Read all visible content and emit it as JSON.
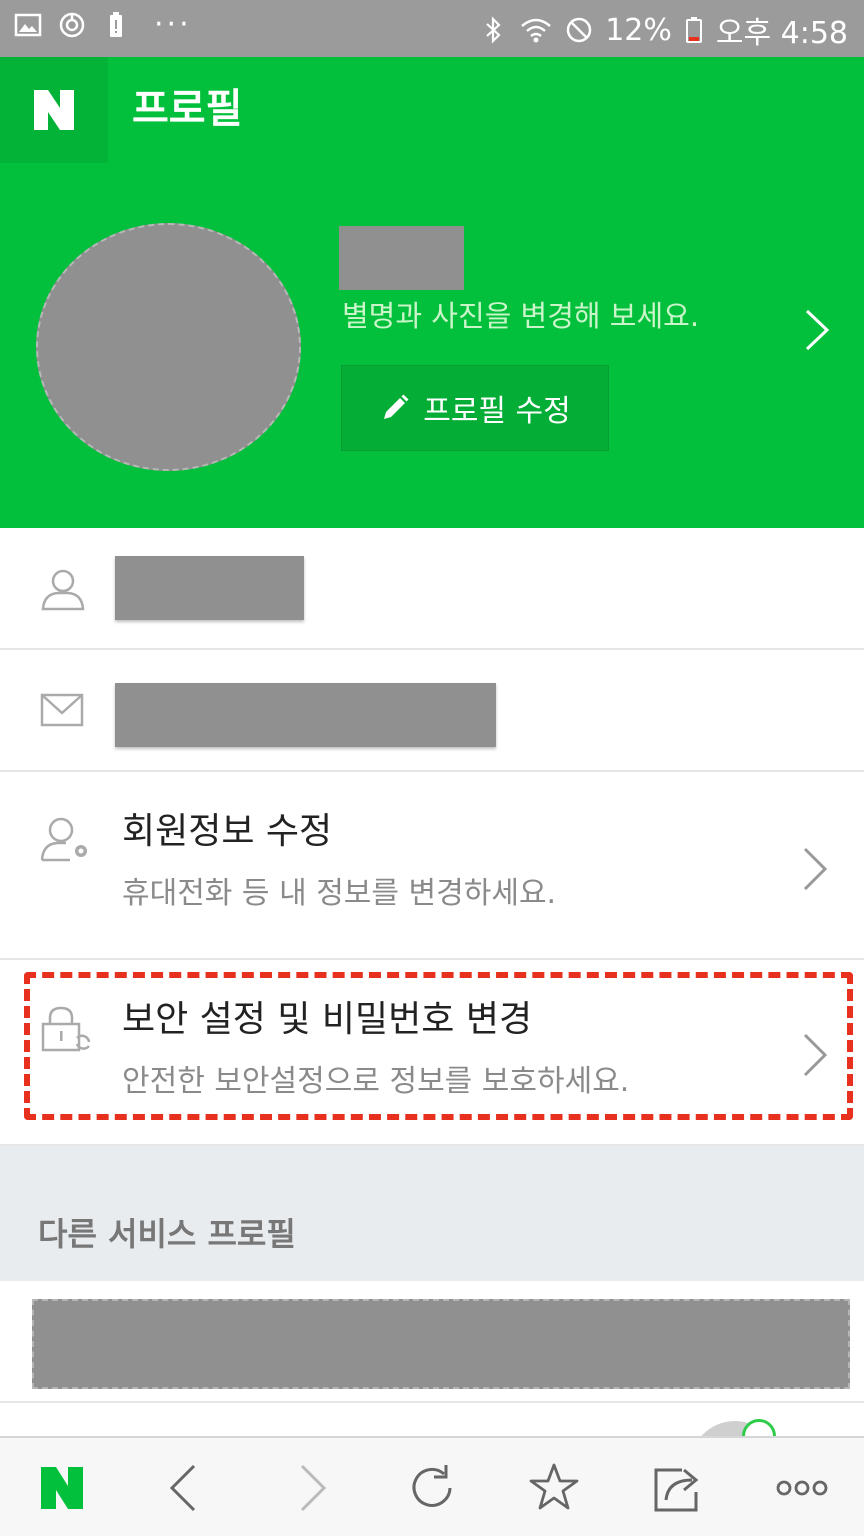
{
  "status_bar": {
    "battery_percent": "12%",
    "time": "오후 4:58",
    "left_icons": [
      "image-icon",
      "sync-icon",
      "battery-saver-icon",
      "more-dots-icon"
    ],
    "right_icons": [
      "bluetooth-icon",
      "wifi-icon",
      "do-not-disturb-icon",
      "battery-low-icon"
    ],
    "dots": "···"
  },
  "app_bar": {
    "logo": "N",
    "title": "프로필"
  },
  "profile": {
    "subtitle": "별명과 사진을 변경해 보세요.",
    "edit_button_label": "프로필 수정",
    "edit_icon": "pencil-icon",
    "chevron": "chevron-right-icon"
  },
  "rows": {
    "id_icon": "user-icon",
    "email_icon": "mail-icon",
    "member_info": {
      "title": "회원정보 수정",
      "desc": "휴대전화 등 내 정보를 변경하세요.",
      "icon": "user-settings-icon"
    },
    "security": {
      "title": "보안 설정 및 비밀번호 변경",
      "desc": "안전한 보안설정으로 정보를 보호하세요.",
      "icon": "lock-refresh-icon"
    }
  },
  "other_services": {
    "section_label": "다른 서비스 프로필"
  },
  "toolbar": {
    "items": [
      "naver-home-icon",
      "back-icon",
      "forward-icon",
      "refresh-icon",
      "bookmark-star-icon",
      "share-icon",
      "more-icon"
    ]
  },
  "colors": {
    "brand_green": "#03c03c",
    "brand_green_dark": "#03b338",
    "highlight_red": "#e8301f",
    "redaction_gray": "#909090"
  }
}
